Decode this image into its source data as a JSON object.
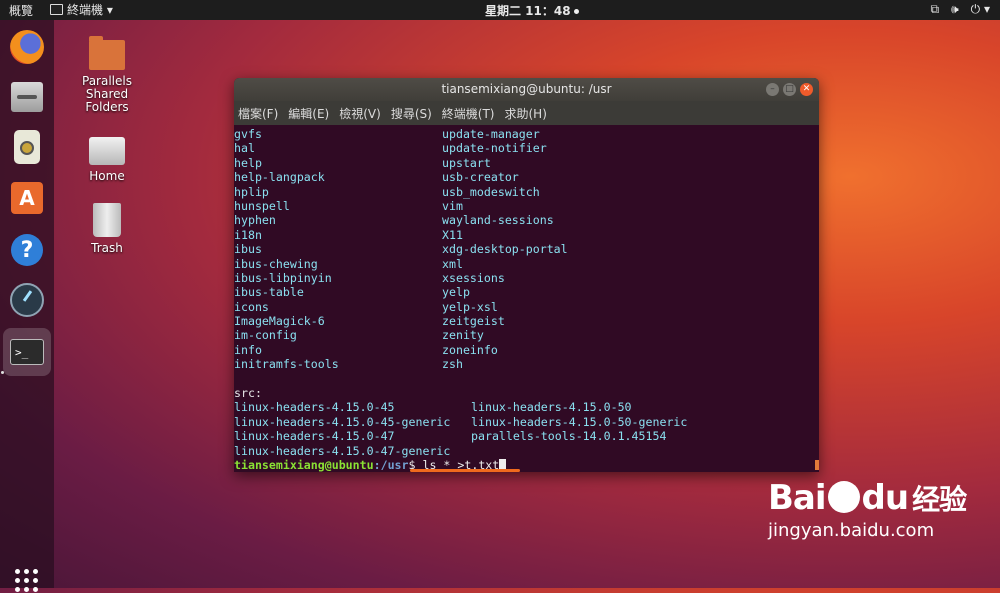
{
  "topbar": {
    "activities": "概覽",
    "app_menu": "終端機 ▾",
    "clock": "星期二 11：48",
    "tray_icons": [
      "network-icon",
      "volume-icon",
      "power-icon"
    ]
  },
  "dock": {
    "items": [
      "firefox",
      "files",
      "rhythmbox",
      "software",
      "help",
      "system-tool",
      "terminal"
    ]
  },
  "desktop": {
    "icons": [
      {
        "label": "Parallels\nShared\nFolders"
      },
      {
        "label": "Home"
      },
      {
        "label": "Trash"
      }
    ]
  },
  "window": {
    "title": "tiansemixiang@ubuntu: /usr",
    "menu": [
      "檔案(F)",
      "編輯(E)",
      "檢視(V)",
      "搜尋(S)",
      "終端機(T)",
      "求助(H)"
    ],
    "listing": [
      [
        "gvfs",
        "update-manager"
      ],
      [
        "hal",
        "update-notifier"
      ],
      [
        "help",
        "upstart"
      ],
      [
        "help-langpack",
        "usb-creator"
      ],
      [
        "hplip",
        "usb_modeswitch"
      ],
      [
        "hunspell",
        "vim"
      ],
      [
        "hyphen",
        "wayland-sessions"
      ],
      [
        "i18n",
        "X11"
      ],
      [
        "ibus",
        "xdg-desktop-portal"
      ],
      [
        "ibus-chewing",
        "xml"
      ],
      [
        "ibus-libpinyin",
        "xsessions"
      ],
      [
        "ibus-table",
        "yelp"
      ],
      [
        "icons",
        "yelp-xsl"
      ],
      [
        "ImageMagick-6",
        "zeitgeist"
      ],
      [
        "im-config",
        "zenity"
      ],
      [
        "info",
        "zoneinfo"
      ],
      [
        "initramfs-tools",
        "zsh"
      ]
    ],
    "src_header": "src:",
    "src_listing": [
      [
        "linux-headers-4.15.0-45",
        "linux-headers-4.15.0-50"
      ],
      [
        "linux-headers-4.15.0-45-generic",
        "linux-headers-4.15.0-50-generic"
      ],
      [
        "linux-headers-4.15.0-47",
        "parallels-tools-14.0.1.45154"
      ],
      [
        "linux-headers-4.15.0-47-generic",
        ""
      ]
    ],
    "prompt_user": "tiansemixiang@ubuntu",
    "prompt_path": ":/usr",
    "command": "$ ls * >t.txt"
  },
  "watermark": {
    "brand_left": "Bai",
    "brand_right": "du",
    "brand_cn": "经验",
    "url": "jingyan.baidu.com"
  },
  "colors": {
    "terminal_bg": "#300a24",
    "dir_text": "#8ae0f0",
    "prompt_user": "#8ae234",
    "prompt_path": "#729fcf",
    "highlight_underline": "#f06a1d"
  }
}
